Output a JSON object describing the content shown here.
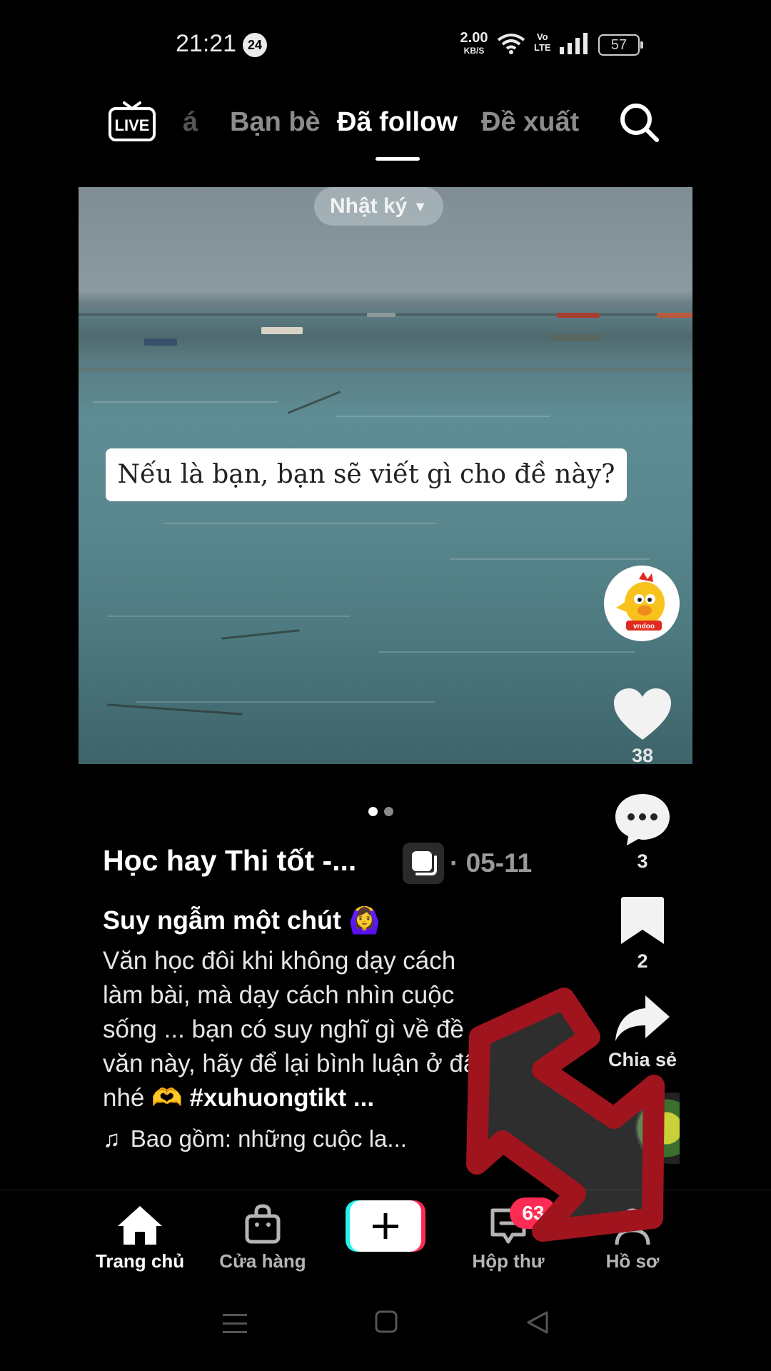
{
  "status_bar": {
    "time": "21:21",
    "notification_count": "24",
    "net_speed_value": "2.00",
    "net_speed_unit": "KB/S",
    "volte_top": "Vo",
    "volte_bottom": "LTE",
    "battery": "57"
  },
  "top_nav": {
    "live_label": "LIVE",
    "tabs": [
      {
        "label": "á",
        "state": "faded"
      },
      {
        "label": "Bạn bè",
        "state": "inactive"
      },
      {
        "label": "Đã follow",
        "state": "active"
      },
      {
        "label": "Đề xuất",
        "state": "inactive"
      }
    ]
  },
  "video": {
    "album_chip": "Nhật ký",
    "overlay_caption": "Nếu là bạn, bạn sẽ viết gì cho đề này?",
    "page_dots": {
      "total": 2,
      "current": 1
    }
  },
  "actions": {
    "avatar_text": "vndoo",
    "likes": "38",
    "comments": "3",
    "saves": "2",
    "share_label": "Chia sẻ"
  },
  "post": {
    "author": "Học hay Thi tốt -...",
    "date": "· 05-11",
    "title": "Suy ngẫm một chút 🙆‍♀️",
    "description": "Văn học đôi khi không dạy cách làm bài, mà dạy cách nhìn cuộc sống ... bạn có suy nghĩ gì về đề văn này, hãy để lại bình luận ở đây nhé 🫶",
    "hashtag": "#xuhuongtikt ...",
    "music": "Bao gồm: những cuộc la..."
  },
  "bottom_nav": {
    "home": "Trang chủ",
    "shop": "Cửa hàng",
    "inbox": "Hộp thư",
    "inbox_badge": "63",
    "profile": "Hồ sơ"
  },
  "colors": {
    "accent_pink": "#fe2c55",
    "accent_cyan": "#25f4ee",
    "annotation_red": "#a0141e"
  }
}
